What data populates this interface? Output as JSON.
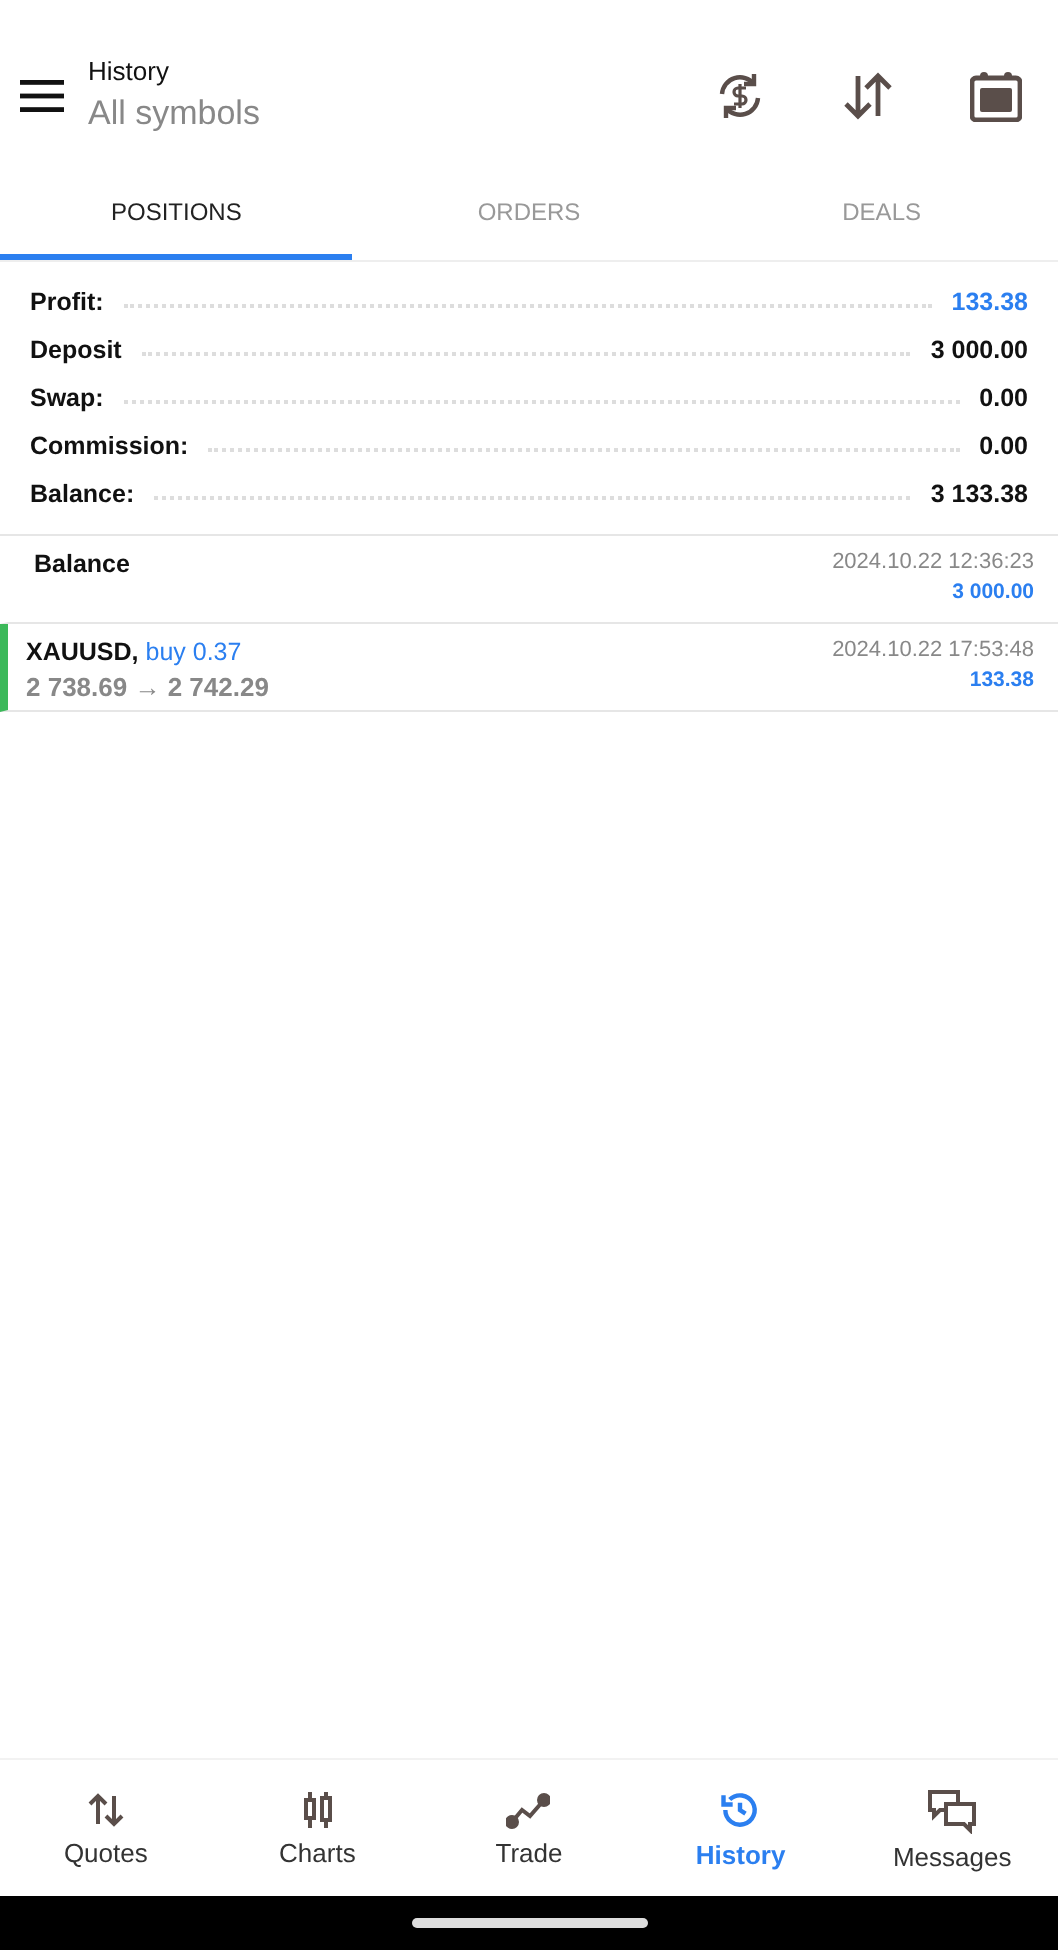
{
  "header": {
    "title": "History",
    "subtitle": "All symbols"
  },
  "tabs": [
    {
      "label": "POSITIONS",
      "selected": true
    },
    {
      "label": "ORDERS",
      "selected": false
    },
    {
      "label": "DEALS",
      "selected": false
    }
  ],
  "summary": [
    {
      "label": "Profit:",
      "value": "133.38",
      "accent": true
    },
    {
      "label": "Deposit",
      "value": "3 000.00",
      "accent": false
    },
    {
      "label": "Swap:",
      "value": "0.00",
      "accent": false
    },
    {
      "label": "Commission:",
      "value": "0.00",
      "accent": false
    },
    {
      "label": "Balance:",
      "value": "3 133.38",
      "accent": false
    }
  ],
  "entries": [
    {
      "kind": "balance",
      "title": "Balance",
      "time": "2024.10.22 12:36:23",
      "amount": "3 000.00"
    },
    {
      "kind": "trade",
      "symbol": "XAUUSD,",
      "side": "buy 0.37",
      "prices": "2 738.69 → 2 742.29",
      "time": "2024.10.22 17:53:48",
      "amount": "133.38",
      "color": "#3cb95a"
    }
  ],
  "nav": [
    {
      "label": "Quotes",
      "selected": false
    },
    {
      "label": "Charts",
      "selected": false
    },
    {
      "label": "Trade",
      "selected": false
    },
    {
      "label": "History",
      "selected": true
    },
    {
      "label": "Messages",
      "selected": false
    }
  ]
}
